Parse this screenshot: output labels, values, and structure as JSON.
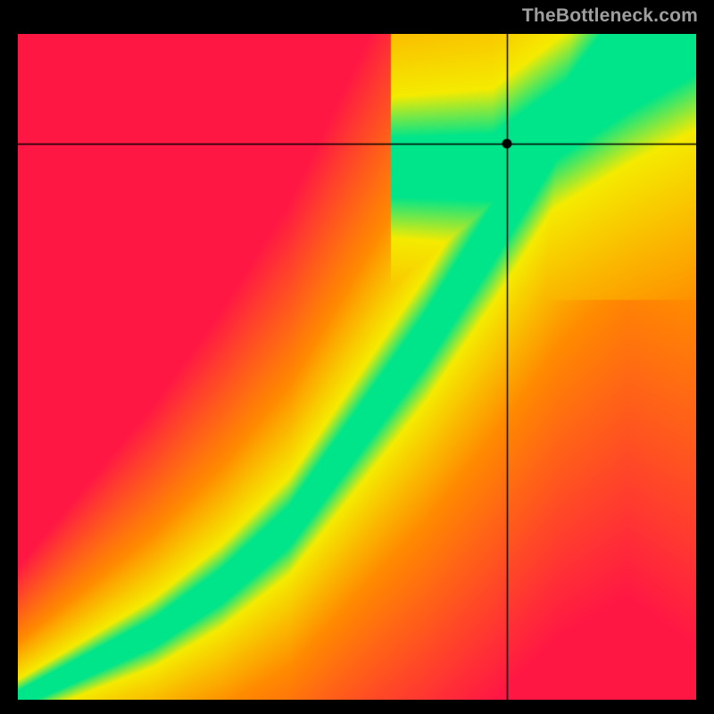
{
  "watermark": "TheBottleneck.com",
  "chart_data": {
    "type": "heatmap",
    "title": "",
    "xlabel": "",
    "ylabel": "",
    "x_range": [
      0,
      1
    ],
    "y_range": [
      0,
      1
    ],
    "marker": {
      "x": 0.722,
      "y": 0.835
    },
    "crosshair": {
      "x": 0.722,
      "y": 0.835
    },
    "ridge": {
      "description": "Green optimal band follows power-like curve from bottom-left to upper-right",
      "points_xy": [
        [
          0.0,
          0.0
        ],
        [
          0.1,
          0.05
        ],
        [
          0.2,
          0.1
        ],
        [
          0.3,
          0.17
        ],
        [
          0.4,
          0.26
        ],
        [
          0.5,
          0.4
        ],
        [
          0.6,
          0.54
        ],
        [
          0.7,
          0.7
        ],
        [
          0.8,
          0.87
        ],
        [
          0.9,
          1.0
        ]
      ]
    },
    "branch": {
      "description": "Secondary green band branches off near upper area toward top-right corner",
      "points_xy": [
        [
          0.7,
          0.8
        ],
        [
          0.8,
          0.87
        ],
        [
          0.9,
          0.94
        ],
        [
          1.0,
          1.0
        ]
      ]
    },
    "color_stops": {
      "optimal": "#00e58a",
      "near": "#f5eb00",
      "mid": "#ff8a00",
      "far": "#ff1744"
    }
  }
}
